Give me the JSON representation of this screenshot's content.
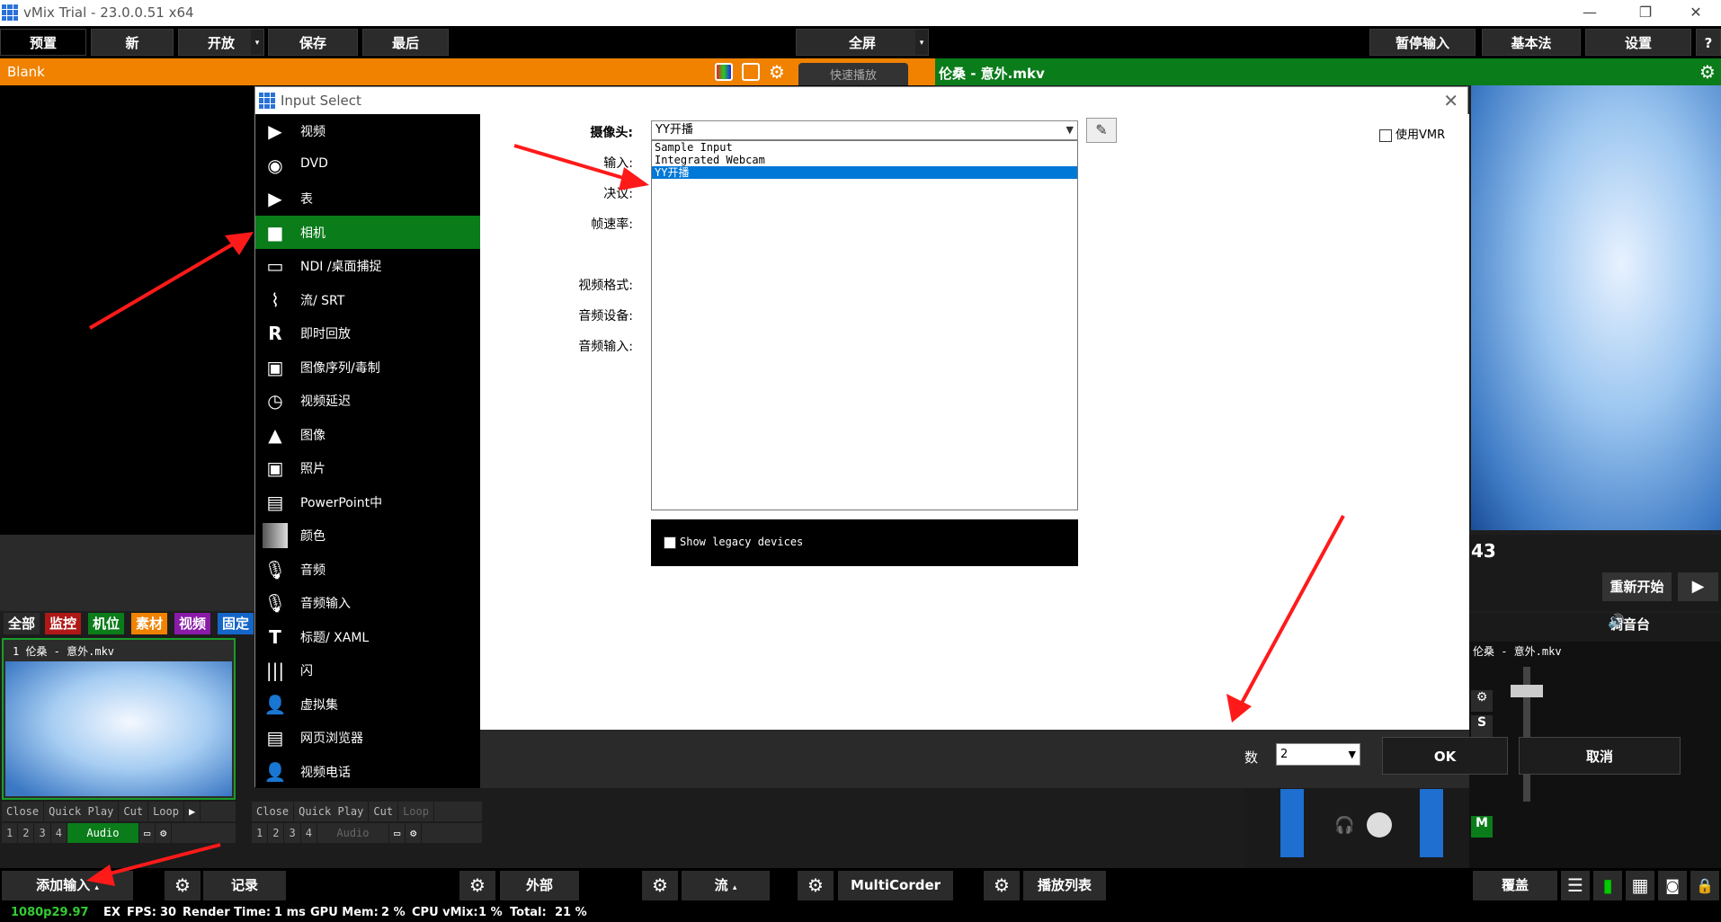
{
  "window": {
    "title": "vMix Trial - 23.0.0.51 x64",
    "min": "—",
    "restore": "❐",
    "close": "✕"
  },
  "toolbar": {
    "preview": "预置",
    "new": "新",
    "open": "开放",
    "save": "保存",
    "last": "最后",
    "fullscreen": "全屏",
    "pause_input": "暂停输入",
    "basic": "基本法",
    "settings": "设置",
    "help": "?"
  },
  "preview_bar": {
    "label": "Blank"
  },
  "program_bar": {
    "label": "伦桑 - 意外.mkv"
  },
  "program_info": {
    "time_suffix": "43",
    "restart": "重新开始",
    "mixer": "调音台"
  },
  "filters": [
    {
      "label": "全部",
      "color": "#2b2b2b"
    },
    {
      "label": "监控",
      "color": "#b01818"
    },
    {
      "label": "机位",
      "color": "#0a7c1a"
    },
    {
      "label": "素材",
      "color": "#f08200"
    },
    {
      "label": "视频",
      "color": "#8a1aa8"
    },
    {
      "label": "固定",
      "color": "#1466c8"
    }
  ],
  "input1": {
    "title": "1   伦桑 - 意外.mkv",
    "controls": [
      "Close",
      "Quick Play",
      "Cut",
      "Loop"
    ],
    "nums": [
      "1",
      "2",
      "3",
      "4"
    ],
    "audio": "Audio"
  },
  "input2": {
    "controls": [
      "Close",
      "Quick Play",
      "Cut",
      "Loop"
    ],
    "nums": [
      "1",
      "2",
      "3",
      "4"
    ],
    "audio": "Audio"
  },
  "mixer_strip": {
    "label": "伦桑 - 意外.mkv",
    "s": "S",
    "m": "M"
  },
  "bottom": {
    "add_input": "添加输入",
    "record": "记录",
    "external": "外部",
    "stream": "流",
    "multicorder": "MultiCorder",
    "playlist": "播放列表",
    "overlay": "覆盖"
  },
  "status": {
    "format": "1080p29.97",
    "ex": "EX",
    "fps_label": "FPS:",
    "fps": "30",
    "render_label": "Render Time:",
    "render": "1 ms",
    "gpu_label": "GPU Mem:",
    "gpu": "2 %",
    "cpu_label": "CPU vMix:",
    "cpu": "1 %",
    "total_label": "Total:",
    "total": "21 %"
  },
  "dialog": {
    "title": "Input Select",
    "types": [
      {
        "label": "视频",
        "icon": "film-icon"
      },
      {
        "label": "DVD",
        "icon": "disc-icon"
      },
      {
        "label": "表",
        "icon": "playlist-icon"
      },
      {
        "label": "相机",
        "icon": "camera-icon",
        "selected": true
      },
      {
        "label": "NDI /桌面捕捉",
        "icon": "monitor-icon"
      },
      {
        "label": "流/ SRT",
        "icon": "antenna-icon"
      },
      {
        "label": "即时回放",
        "icon": "replay-icon"
      },
      {
        "label": "图像序列/毒制",
        "icon": "image-sequence-icon"
      },
      {
        "label": "视频延迟",
        "icon": "clock-icon"
      },
      {
        "label": "图像",
        "icon": "image-icon"
      },
      {
        "label": "照片",
        "icon": "photos-icon"
      },
      {
        "label": "PowerPoint中",
        "icon": "presentation-icon"
      },
      {
        "label": "颜色",
        "icon": "color-icon"
      },
      {
        "label": "音频",
        "icon": "microphone-icon"
      },
      {
        "label": "音频输入",
        "icon": "audio-input-icon"
      },
      {
        "label": "标题/ XAML",
        "icon": "title-icon"
      },
      {
        "label": "闪",
        "icon": "flash-icon"
      },
      {
        "label": "虚拟集",
        "icon": "virtual-set-icon"
      },
      {
        "label": "网页浏览器",
        "icon": "browser-icon"
      },
      {
        "label": "视频电话",
        "icon": "video-call-icon"
      }
    ],
    "labels": {
      "camera": "摄像头:",
      "input": "输入:",
      "resolution": "决议:",
      "framerate": "帧速率:",
      "video_format": "视频格式:",
      "audio_device": "音频设备:",
      "audio_input": "音频输入:"
    },
    "camera_value": "YY开播",
    "camera_options": [
      "Sample Input",
      "Integrated Webcam",
      "YY开播"
    ],
    "use_vmr": "使用VMR",
    "legacy": "Show legacy devices",
    "count_label": "数",
    "count_value": "2",
    "ok": "OK",
    "cancel": "取消",
    "hidden_behind": "快速播放"
  }
}
